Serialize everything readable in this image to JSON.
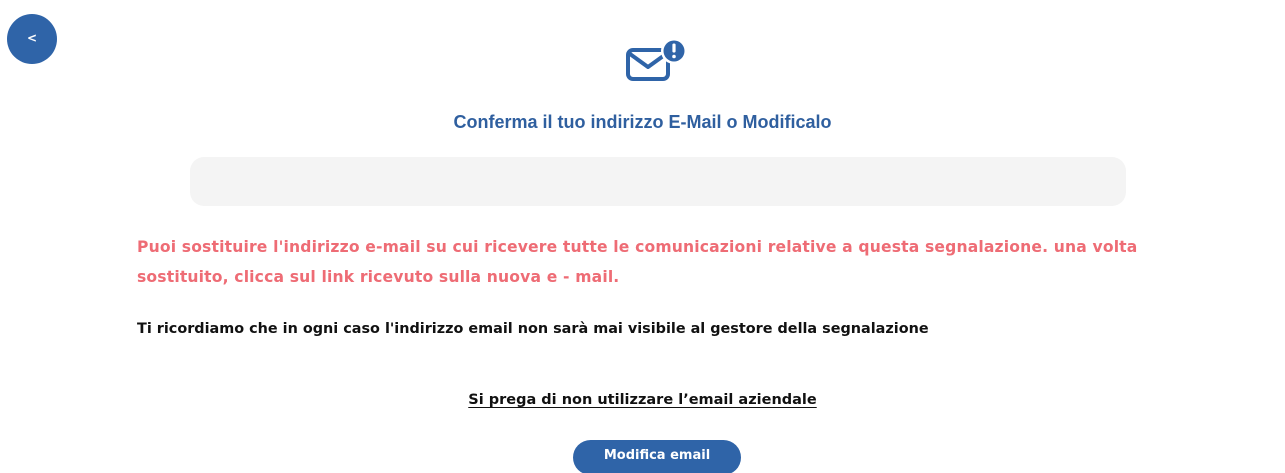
{
  "back_button": {
    "label": "<"
  },
  "icons": {
    "header": "email-alert-icon"
  },
  "header": {
    "title": "Conferma il tuo indirizzo E-Mail o Modificalo"
  },
  "email_field": {
    "value": "",
    "placeholder": ""
  },
  "messages": {
    "warning": "Puoi sostituire l'indirizzo e-mail su cui ricevere tutte le comunicazioni relative a questa segnalazione. una volta sostituito, clicca sul link ricevuto sulla nuova e - mail.",
    "notice": "Ti ricordiamo che in ogni caso l'indirizzo email non sarà mai visibile al gestore della segnalazione",
    "company_email": "Si prega di non utilizzare l’email aziendale"
  },
  "actions": {
    "submit_label": "Modifica email"
  },
  "colors": {
    "primary": "#2f64a8",
    "title": "#2f5f9f",
    "warning": "#ee6c75",
    "input_bg": "#f4f4f4"
  }
}
